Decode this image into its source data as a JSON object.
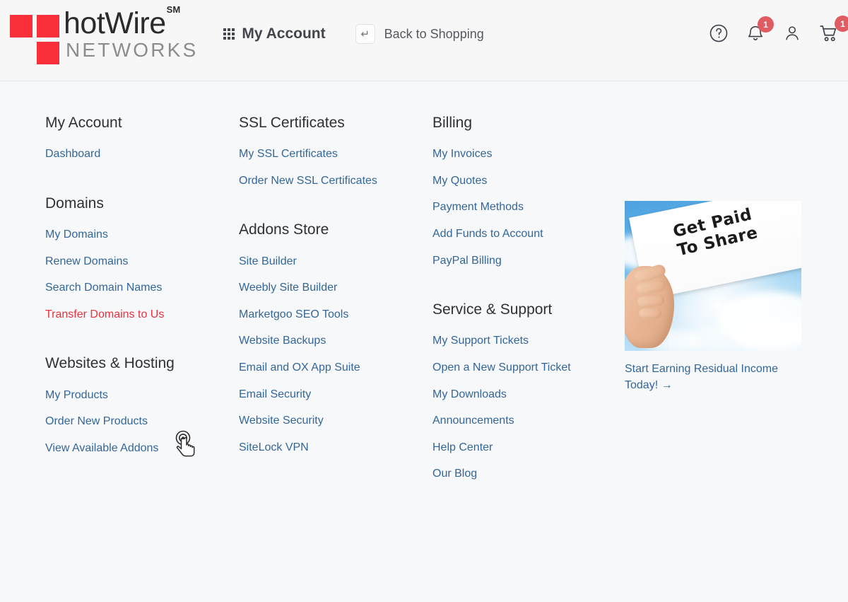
{
  "header": {
    "logo": {
      "brand": "hotWire",
      "sm": "SM",
      "sub": "NETWORKS"
    },
    "my_account": {
      "label": "My Account",
      "icon": "grid-apps-icon"
    },
    "back_to_shopping": {
      "label": "Back to Shopping",
      "icon": "return-arrow-icon"
    },
    "icons": {
      "help": {
        "name": "help-circle-icon",
        "glyph": "?"
      },
      "notifications": {
        "name": "bell-icon",
        "badge": "1"
      },
      "account": {
        "name": "user-icon"
      },
      "cart": {
        "name": "shopping-cart-icon",
        "badge": "1"
      }
    }
  },
  "colors": {
    "link": "#336699",
    "link_hover": "#e8323c",
    "brand_red": "#f92f3a",
    "badge": "#e05c63",
    "heading": "#2e3237",
    "page_bg": "#f7f8fa",
    "header_bg": "#f7f7f7"
  },
  "columns": [
    {
      "groups": [
        {
          "title": "My Account",
          "links": [
            {
              "label": "Dashboard",
              "state": "normal"
            }
          ]
        },
        {
          "title": "Domains",
          "links": [
            {
              "label": "My Domains",
              "state": "normal"
            },
            {
              "label": "Renew Domains",
              "state": "normal"
            },
            {
              "label": "Search Domain Names",
              "state": "normal"
            },
            {
              "label": "Transfer Domains to Us",
              "state": "hovered"
            }
          ]
        },
        {
          "title": "Websites & Hosting",
          "links": [
            {
              "label": "My Products",
              "state": "normal"
            },
            {
              "label": "Order New Products",
              "state": "normal"
            },
            {
              "label": "View Available Addons",
              "state": "normal"
            }
          ]
        }
      ]
    },
    {
      "groups": [
        {
          "title": "SSL Certificates",
          "links": [
            {
              "label": "My SSL Certificates",
              "state": "normal"
            },
            {
              "label": "Order New SSL Certificates",
              "state": "normal"
            }
          ]
        },
        {
          "title": "Addons Store",
          "links": [
            {
              "label": "Site Builder",
              "state": "normal"
            },
            {
              "label": "Weebly Site Builder",
              "state": "normal"
            },
            {
              "label": "Marketgoo SEO Tools",
              "state": "normal"
            },
            {
              "label": "Website Backups",
              "state": "normal"
            },
            {
              "label": "Email and OX App Suite",
              "state": "normal"
            },
            {
              "label": "Email Security",
              "state": "normal"
            },
            {
              "label": "Website Security",
              "state": "normal"
            },
            {
              "label": "SiteLock VPN",
              "state": "normal"
            }
          ]
        }
      ]
    },
    {
      "groups": [
        {
          "title": "Billing",
          "links": [
            {
              "label": "My Invoices",
              "state": "normal"
            },
            {
              "label": "My Quotes",
              "state": "normal"
            },
            {
              "label": "Payment Methods",
              "state": "normal"
            },
            {
              "label": "Add Funds to Account",
              "state": "normal"
            },
            {
              "label": "PayPal Billing",
              "state": "normal"
            }
          ]
        },
        {
          "title": "Service & Support",
          "links": [
            {
              "label": "My Support Tickets",
              "state": "normal"
            },
            {
              "label": "Open a New Support Ticket",
              "state": "normal"
            },
            {
              "label": "My Downloads",
              "state": "normal"
            },
            {
              "label": "Announcements",
              "state": "normal"
            },
            {
              "label": "Help Center",
              "state": "normal"
            },
            {
              "label": "Our Blog",
              "state": "normal"
            }
          ]
        }
      ]
    }
  ],
  "promo": {
    "image_alt": "hand-holding-sign-photo",
    "sign_text": "Get Paid\nTo Share",
    "caption": "Start Earning Residual Income Today! →"
  },
  "cursor": {
    "name": "pointer-hand-cursor"
  }
}
